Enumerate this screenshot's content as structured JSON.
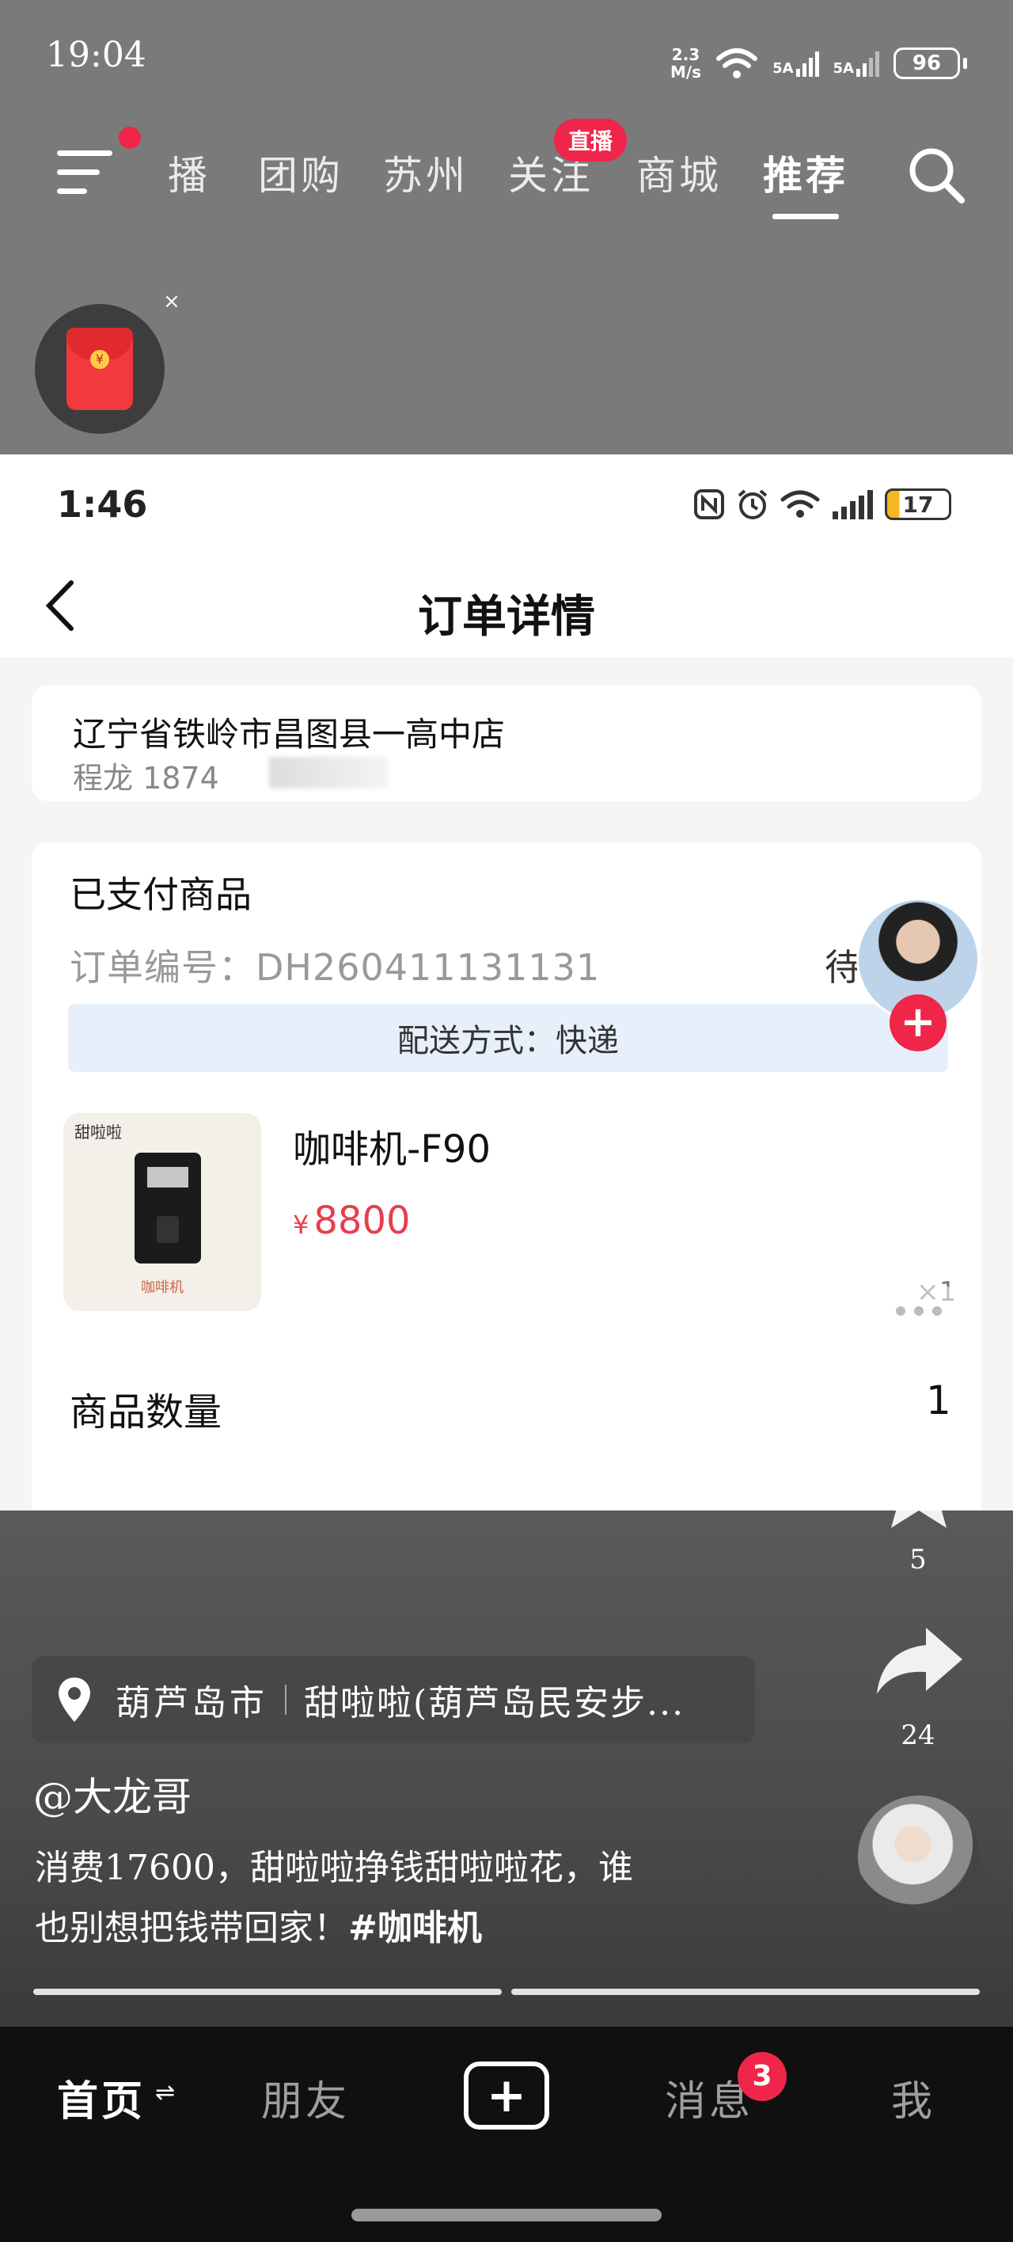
{
  "outer_status": {
    "time": "19:04",
    "net_speed_value": "2.3",
    "net_speed_unit": "M/s",
    "sim1": "5A",
    "sim2": "5A",
    "battery": "96"
  },
  "top_nav": {
    "tabs": [
      "播",
      "团购",
      "苏州",
      "关注",
      "商城",
      "推荐"
    ],
    "active_tab": "推荐",
    "live_badge": "直播"
  },
  "red_packet": {
    "close": "×"
  },
  "inner_status": {
    "time": "1:46",
    "battery": "17"
  },
  "order": {
    "title": "订单详情",
    "address": "辽宁省铁岭市昌图县一高中店",
    "contact": "程龙 1874",
    "paid_section_title": "已支付商品",
    "order_number_label": "订单编号：",
    "order_number": "DH260411131131",
    "status_partial": "待",
    "delivery": "配送方式：快递",
    "thumb_brand": "甜啦啦",
    "thumb_caption": "咖啡机",
    "product_name": "咖啡机-F90",
    "currency": "¥",
    "price": "8800",
    "qty_x": "×1",
    "qty_label": "商品数量",
    "qty_value": "1"
  },
  "side_actions": {
    "follow": "+",
    "favorites_count": "5",
    "share_count": "24"
  },
  "video_info": {
    "location_city": "葫芦岛市",
    "location_shop": "甜啦啦(葫芦岛民安步...",
    "author": "@大龙哥",
    "caption_line1": "消费17600，甜啦啦挣钱甜啦啦花，谁",
    "caption_line2": "也别想把钱带回家！",
    "hashtag": "#咖啡机"
  },
  "bottom_nav": {
    "home": "首页",
    "friends": "朋友",
    "create": "+",
    "messages": "消息",
    "messages_badge": "3",
    "me": "我"
  },
  "colors": {
    "accent": "#f0254a",
    "price": "#e83d4c",
    "delivery_bg": "#e6effa"
  }
}
